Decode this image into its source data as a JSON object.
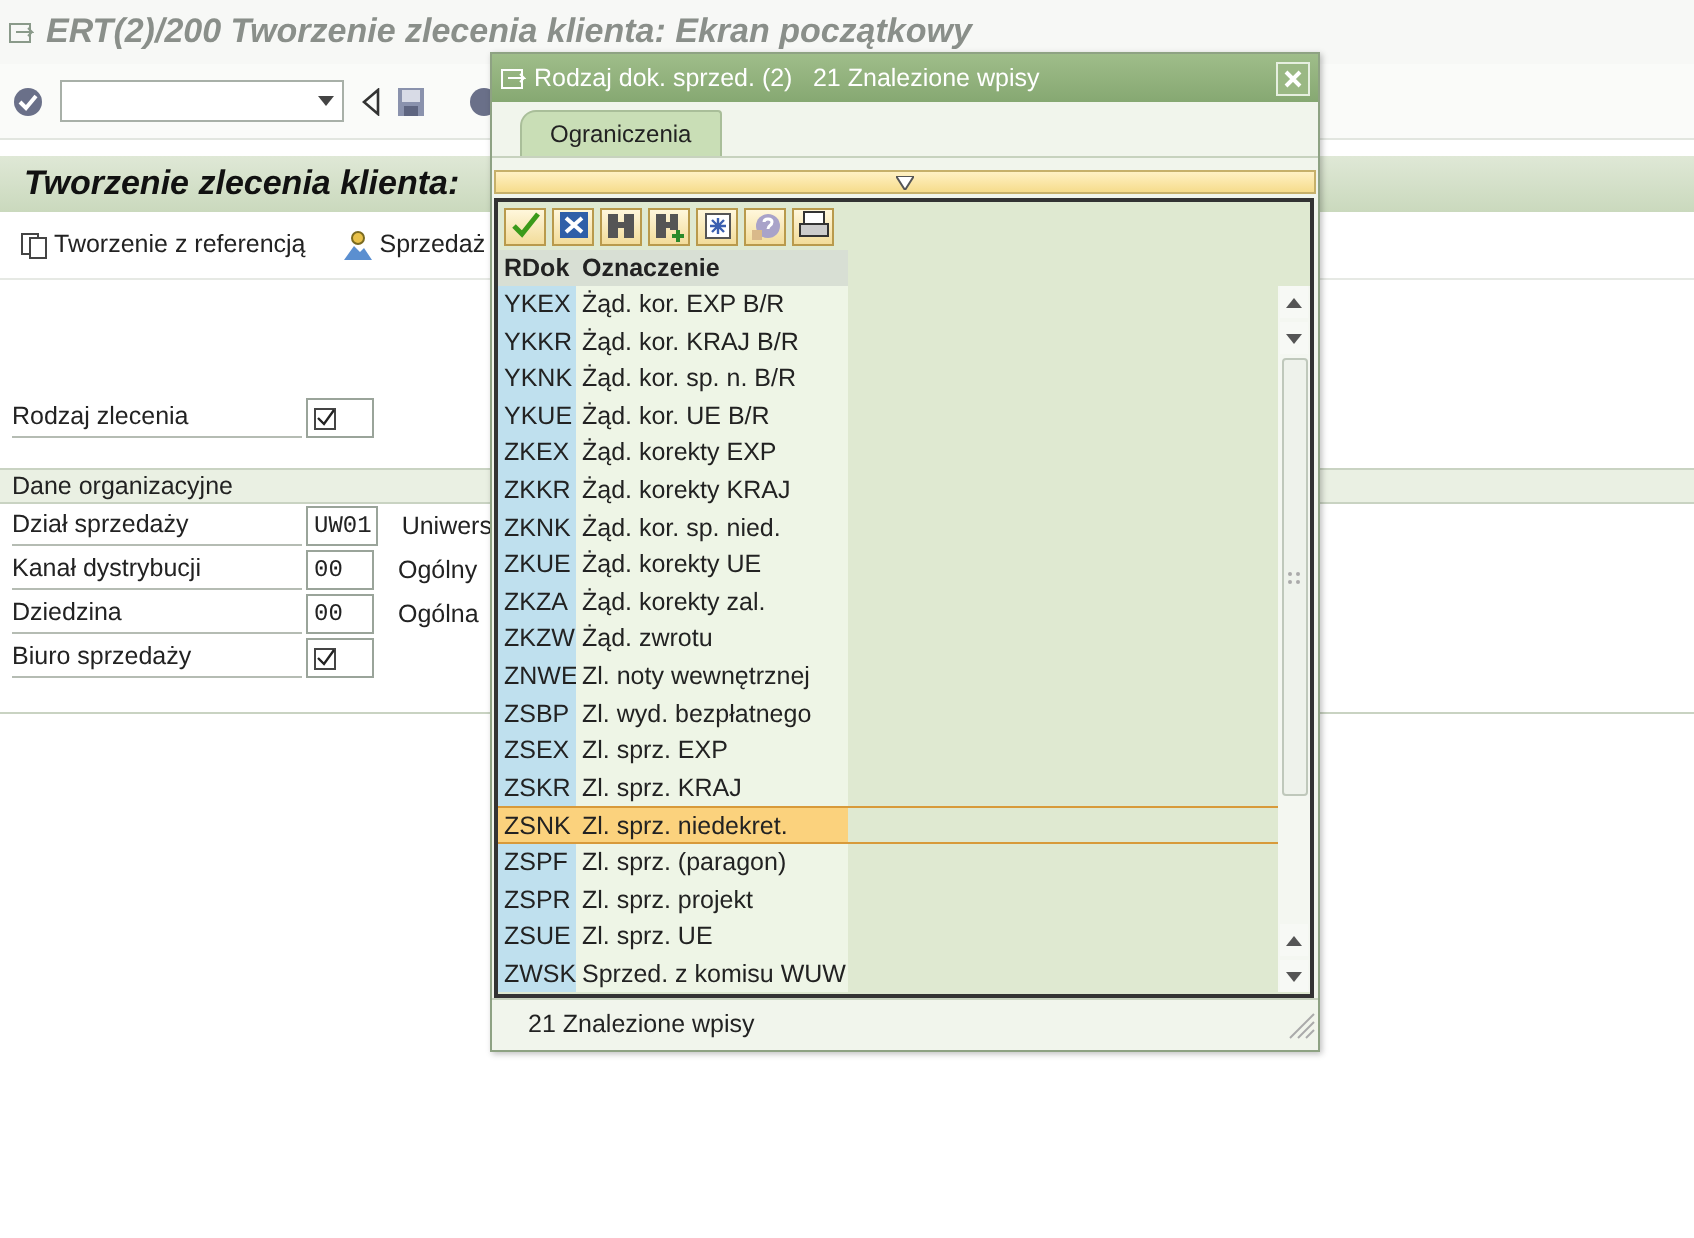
{
  "window": {
    "title": "ERT(2)/200 Tworzenie zlecenia klienta: Ekran początkowy"
  },
  "screen_header": {
    "title": "Tworzenie zlecenia klienta:"
  },
  "app_toolbar": [
    {
      "label": "Tworzenie z referencją"
    },
    {
      "label": "Sprzedaż"
    }
  ],
  "order_type": {
    "label": "Rodzaj zlecenia",
    "required": true
  },
  "org_data": {
    "title": "Dane organizacyjne",
    "fields": [
      {
        "label": "Dział sprzedaży",
        "required": false,
        "value": "UW01",
        "description": "Uniwers"
      },
      {
        "label": "Kanał dystrybucji",
        "required": false,
        "value": "00",
        "description": "Ogólny"
      },
      {
        "label": "Dziedzina",
        "required": false,
        "value": "00",
        "description": "Ogólna"
      },
      {
        "label": "Biuro sprzedaży",
        "required": true
      }
    ]
  },
  "dialog": {
    "title": "Rodzaj dok. sprzed. (2)",
    "subtitle": "21 Znalezione wpisy",
    "tabs": [
      {
        "label": "Ograniczenia",
        "selected": true
      }
    ],
    "columns": [
      "RDok",
      "Oznaczenie"
    ],
    "rows": [
      {
        "code": "YKEX",
        "name": "Żąd. kor. EXP B/R",
        "selected": false
      },
      {
        "code": "YKKR",
        "name": "Żąd. kor. KRAJ B/R",
        "selected": false
      },
      {
        "code": "YKNK",
        "name": "Żąd. kor. sp. n. B/R",
        "selected": false
      },
      {
        "code": "YKUE",
        "name": "Żąd. kor. UE B/R",
        "selected": false
      },
      {
        "code": "ZKEX",
        "name": "Żąd. korekty EXP",
        "selected": false
      },
      {
        "code": "ZKKR",
        "name": "Żąd. korekty KRAJ",
        "selected": false
      },
      {
        "code": "ZKNK",
        "name": "Żąd. kor. sp. nied.",
        "selected": false
      },
      {
        "code": "ZKUE",
        "name": "Żąd. korekty UE",
        "selected": false
      },
      {
        "code": "ZKZA",
        "name": "Żąd. korekty zal.",
        "selected": false
      },
      {
        "code": "ZKZW",
        "name": "Żąd. zwrotu",
        "selected": false
      },
      {
        "code": "ZNWE",
        "name": "Zl. noty wewnętrznej",
        "selected": false
      },
      {
        "code": "ZSBP",
        "name": "Zl. wyd. bezpłatnego",
        "selected": false
      },
      {
        "code": "ZSEX",
        "name": "Zl. sprz. EXP",
        "selected": false
      },
      {
        "code": "ZSKR",
        "name": "Zl. sprz. KRAJ",
        "selected": false
      },
      {
        "code": "ZSNK",
        "name": "Zl. sprz. niedekret.",
        "selected": true
      },
      {
        "code": "ZSPF",
        "name": "Zl. sprz. (paragon)",
        "selected": false
      },
      {
        "code": "ZSPR",
        "name": "Zl. sprz. projekt",
        "selected": false
      },
      {
        "code": "ZSUE",
        "name": "Zl. sprz. UE",
        "selected": false
      },
      {
        "code": "ZWSK",
        "name": "Sprzed. z komisu WUW",
        "selected": false
      }
    ],
    "status": "21 Znalezione wpisy"
  }
}
